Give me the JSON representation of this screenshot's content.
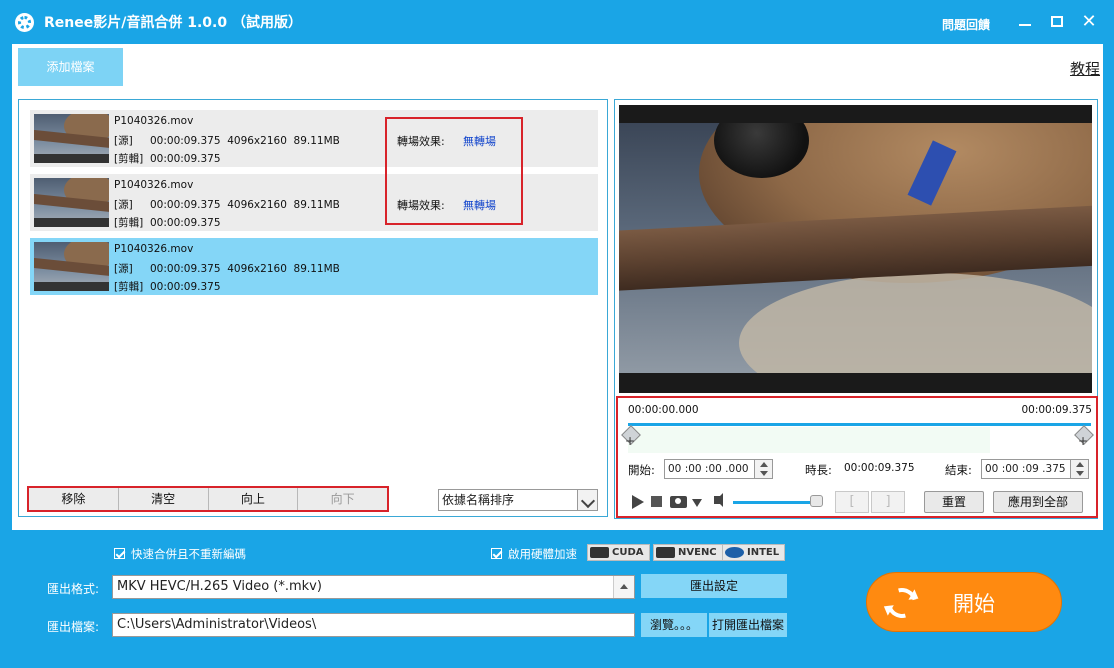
{
  "title_bar": {
    "app_title": "Renee影片/音訊合併 1.0.0 （試用版）",
    "help_link": "問題回饋",
    "close_glyph": "✕"
  },
  "toolbar": {
    "add_file": "添加檔案",
    "tutorial": "教程"
  },
  "file_list": {
    "items": [
      {
        "name": "P1040326.mov",
        "source_tag": "[源]",
        "source_info": "00:00:09.375  4096x2160  89.11MB",
        "cut_tag": "[剪輯]",
        "cut_duration": "00:00:09.375",
        "transition_label": "轉場效果:",
        "transition_value": "無轉場",
        "selected": false
      },
      {
        "name": "P1040326.mov",
        "source_tag": "[源]",
        "source_info": "00:00:09.375  4096x2160  89.11MB",
        "cut_tag": "[剪輯]",
        "cut_duration": "00:00:09.375",
        "transition_label": "轉場效果:",
        "transition_value": "無轉場",
        "selected": false
      },
      {
        "name": "P1040326.mov",
        "source_tag": "[源]",
        "source_info": "00:00:09.375  4096x2160  89.11MB",
        "cut_tag": "[剪輯]",
        "cut_duration": "00:00:09.375",
        "transition_label": "",
        "transition_value": "",
        "selected": true
      }
    ],
    "buttons": {
      "remove": "移除",
      "clear": "清空",
      "move_up": "向上",
      "move_down": "向下"
    },
    "sort_select": "依據名稱排序"
  },
  "preview": {
    "time_start": "00:00:00.000",
    "time_end": "00:00:09.375",
    "start_label": "開始:",
    "start_value": "00 :00 :00 .000",
    "duration_label": "時長:",
    "duration_value": "00:00:09.375",
    "end_label": "結束:",
    "end_value": "00 :00 :09 .375",
    "bracket_open": "[",
    "bracket_close": "]",
    "reset": "重置",
    "apply_all": "應用到全部",
    "volume_level": 0.9
  },
  "settings": {
    "fast_merge": "快速合併且不重新編碼",
    "hw_accel": "啟用硬體加速",
    "accel_badges": [
      "CUDA",
      "NVENC",
      "INTEL"
    ],
    "format_label": "匯出格式:",
    "format_value": "MKV HEVC/H.265 Video (*.mkv)",
    "export_settings": "匯出設定",
    "output_label": "匯出檔案:",
    "output_path": "C:\\Users\\Administrator\\Videos\\",
    "browse": "瀏覽。。。",
    "open_folder": "打開匯出檔案",
    "start": "開始"
  },
  "colors": {
    "accent": "#1aa5e6",
    "start_button": "#ff8a10",
    "highlight_box": "#d8232a",
    "selected_row": "#84d6f7"
  }
}
